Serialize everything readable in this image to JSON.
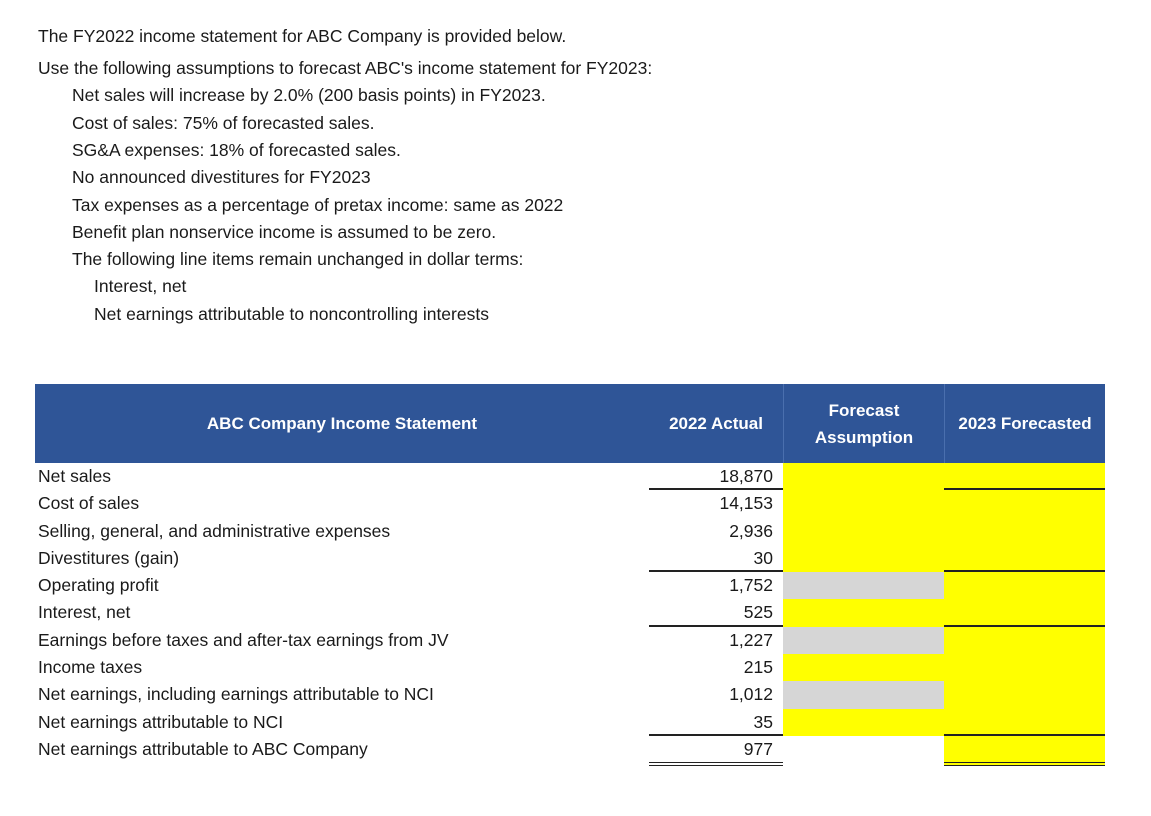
{
  "intro": {
    "title_line": "The FY2022 income statement for ABC Company is provided below.",
    "instruction": "Use the following assumptions to forecast ABC's income statement for FY2023:",
    "assumptions": [
      "Net sales will increase by 2.0% (200 basis points) in FY2023.",
      "Cost of sales:  75% of forecasted sales.",
      "SG&A expenses:  18% of forecasted sales.",
      "No announced divestitures for FY2023",
      "Tax expenses as a percentage of pretax income: same as 2022",
      "Benefit plan nonservice income is assumed to be zero.",
      "The following line items remain unchanged in dollar terms:"
    ],
    "unchanged_items": [
      "Interest, net",
      "Net earnings attributable to noncontrolling interests"
    ]
  },
  "table": {
    "headers": {
      "label": "ABC Company Income Statement",
      "actual": "2022 Actual",
      "assumption": "Forecast Assumption",
      "forecast": "2023 Forecasted"
    },
    "colors": {
      "header_bg": "#2F5597",
      "input_cell": "#FFFF00",
      "disabled_cell": "#D6D6D6"
    },
    "rows": [
      {
        "label": "Net sales",
        "actual": "18,870",
        "assumption": "",
        "forecast": ""
      },
      {
        "label": "Cost of sales",
        "actual": "14,153",
        "assumption": "",
        "forecast": ""
      },
      {
        "label": "Selling, general, and administrative expenses",
        "actual": "2,936",
        "assumption": "",
        "forecast": ""
      },
      {
        "label": "Divestitures (gain)",
        "actual": "30",
        "assumption": "",
        "forecast": ""
      },
      {
        "label": "Operating profit",
        "actual": "1,752",
        "assumption": "",
        "forecast": ""
      },
      {
        "label": "Interest, net",
        "actual": "525",
        "assumption": "",
        "forecast": ""
      },
      {
        "label": "Earnings before taxes and after-tax earnings from JV",
        "actual": "1,227",
        "assumption": "",
        "forecast": ""
      },
      {
        "label": "Income taxes",
        "actual": "215",
        "assumption": "",
        "forecast": ""
      },
      {
        "label": "Net earnings, including earnings attributable to NCI",
        "actual": "1,012",
        "assumption": "",
        "forecast": ""
      },
      {
        "label": "Net earnings attributable to NCI",
        "actual": "35",
        "assumption": "",
        "forecast": ""
      },
      {
        "label": "Net earnings attributable to ABC Company",
        "actual": "977",
        "assumption": "",
        "forecast": ""
      }
    ]
  }
}
